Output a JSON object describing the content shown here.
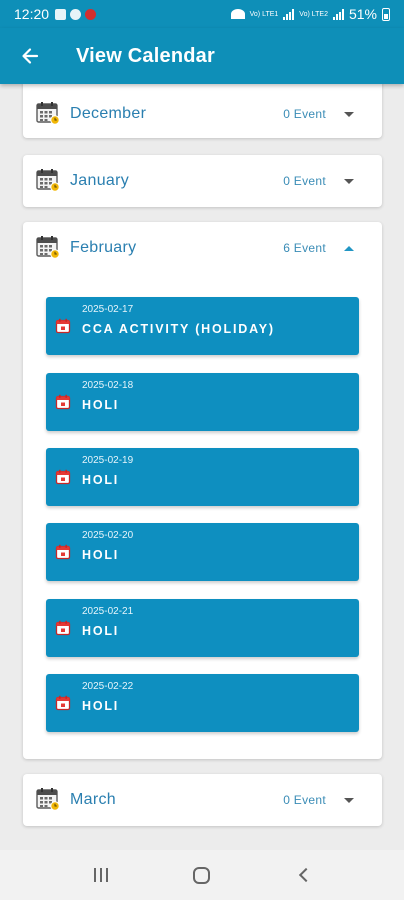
{
  "status_bar": {
    "time": "12:20",
    "network_labels": [
      "Vo) LTE1",
      "Vo) LTE2"
    ],
    "battery": "51%"
  },
  "app_bar": {
    "back_icon": "arrow-back-icon",
    "title": "View Calendar"
  },
  "months": [
    {
      "name": "December",
      "count": "0 Event",
      "expanded": false
    },
    {
      "name": "January",
      "count": "0 Event",
      "expanded": false
    },
    {
      "name": "February",
      "count": "6 Event",
      "expanded": true,
      "events": [
        {
          "date": "2025-02-17",
          "title": "CCA ACTIVITY (HOLIDAY)"
        },
        {
          "date": "2025-02-18",
          "title": "HOLI"
        },
        {
          "date": "2025-02-19",
          "title": "HOLI"
        },
        {
          "date": "2025-02-20",
          "title": "HOLI"
        },
        {
          "date": "2025-02-21",
          "title": "HOLI"
        },
        {
          "date": "2025-02-22",
          "title": "HOLI"
        }
      ]
    },
    {
      "name": "March",
      "count": "0 Event",
      "expanded": false
    }
  ],
  "colors": {
    "primary": "#0e8fb8",
    "event_bg": "#0e8fc0",
    "month_text": "#2a7fb0",
    "background": "#ececec"
  }
}
